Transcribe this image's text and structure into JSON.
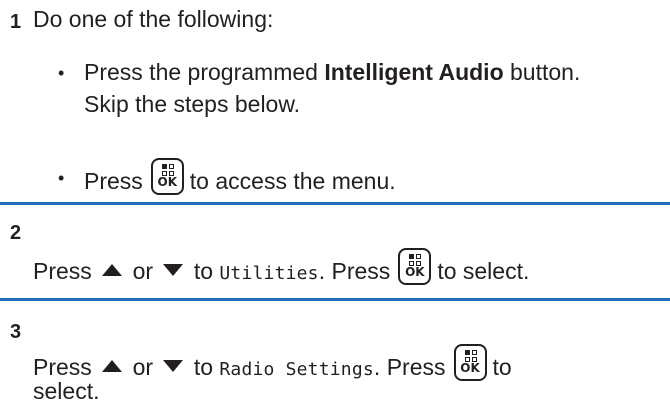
{
  "step1": {
    "number": "1",
    "intro": "Do one of the following:",
    "bullet": "•",
    "opt1_pre": "Press the programmed ",
    "opt1_bold": "Intelligent Audio",
    "opt1_post": " button.",
    "opt1_line2": "Skip the steps below.",
    "opt2_pre": "Press",
    "opt2_post": "to access the menu."
  },
  "step2": {
    "number": "2",
    "press": "Press",
    "or": "or",
    "to": "to",
    "menu_item": "Utilities",
    "press2": ". Press",
    "select": "to select."
  },
  "step3": {
    "number": "3",
    "press": "Press",
    "or": "or",
    "to": "to",
    "menu_item": "Radio Settings",
    "press2": ". Press",
    "to2": "to",
    "select": "select."
  },
  "key": {
    "label": "OK"
  },
  "colors": {
    "rule": "#1f6fb6",
    "text": "#231f20"
  },
  "icons": [
    "ok-menu-key-icon",
    "up-arrow-icon",
    "down-arrow-icon"
  ]
}
